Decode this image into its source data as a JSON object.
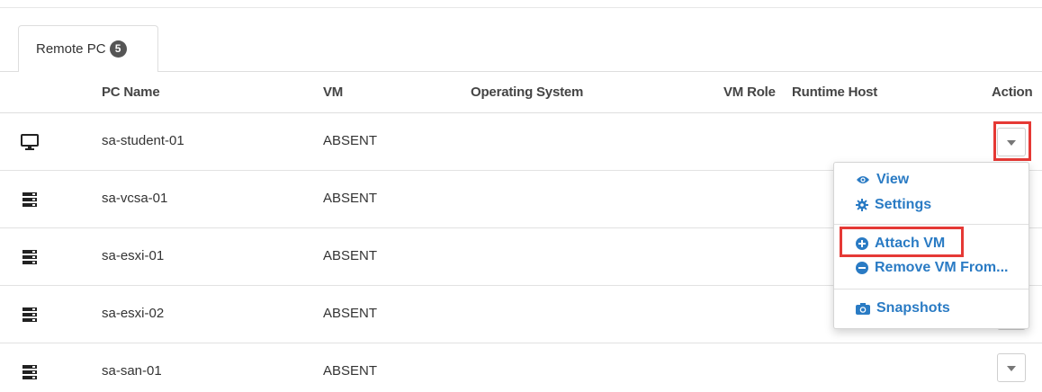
{
  "tab": {
    "label": "Remote PC",
    "count": "5"
  },
  "columns": {
    "pc_name": "PC Name",
    "vm": "VM",
    "os": "Operating System",
    "vm_role": "VM Role",
    "runtime_host": "Runtime Host",
    "action": "Action"
  },
  "rows": [
    {
      "icon": "desktop-icon",
      "name": "sa-student-01",
      "vm": "ABSENT"
    },
    {
      "icon": "server-icon",
      "name": "sa-vcsa-01",
      "vm": "ABSENT"
    },
    {
      "icon": "server-icon",
      "name": "sa-esxi-01",
      "vm": "ABSENT"
    },
    {
      "icon": "server-icon",
      "name": "sa-esxi-02",
      "vm": "ABSENT"
    },
    {
      "icon": "server-icon",
      "name": "sa-san-01",
      "vm": "ABSENT"
    }
  ],
  "menu": {
    "view": "View",
    "settings": "Settings",
    "attach_vm": "Attach VM",
    "remove_vm": "Remove VM From...",
    "snapshots": "Snapshots"
  },
  "colors": {
    "link": "#2a7bc4",
    "highlight": "#e53935",
    "badge": "#555555"
  }
}
